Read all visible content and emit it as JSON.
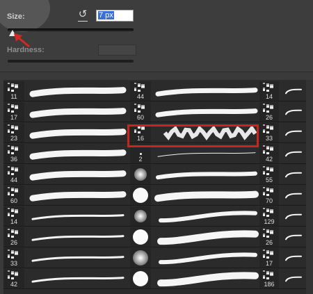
{
  "size": {
    "label": "Size:",
    "value": "7 px"
  },
  "hardness": {
    "label": "Hardness:"
  },
  "presets": {
    "col1": [
      "11",
      "17",
      "23",
      "36",
      "44",
      "60",
      "14",
      "26",
      "33",
      "42"
    ],
    "col2": [
      "44",
      "60",
      "16",
      "2",
      "",
      "",
      "",
      "",
      "",
      ""
    ],
    "col3": [
      "14",
      "26",
      "33",
      "42",
      "55",
      "70",
      "129",
      "26",
      "17",
      "186"
    ]
  },
  "colors": {
    "highlight": "#c8251e",
    "arrow": "#d22a22"
  }
}
